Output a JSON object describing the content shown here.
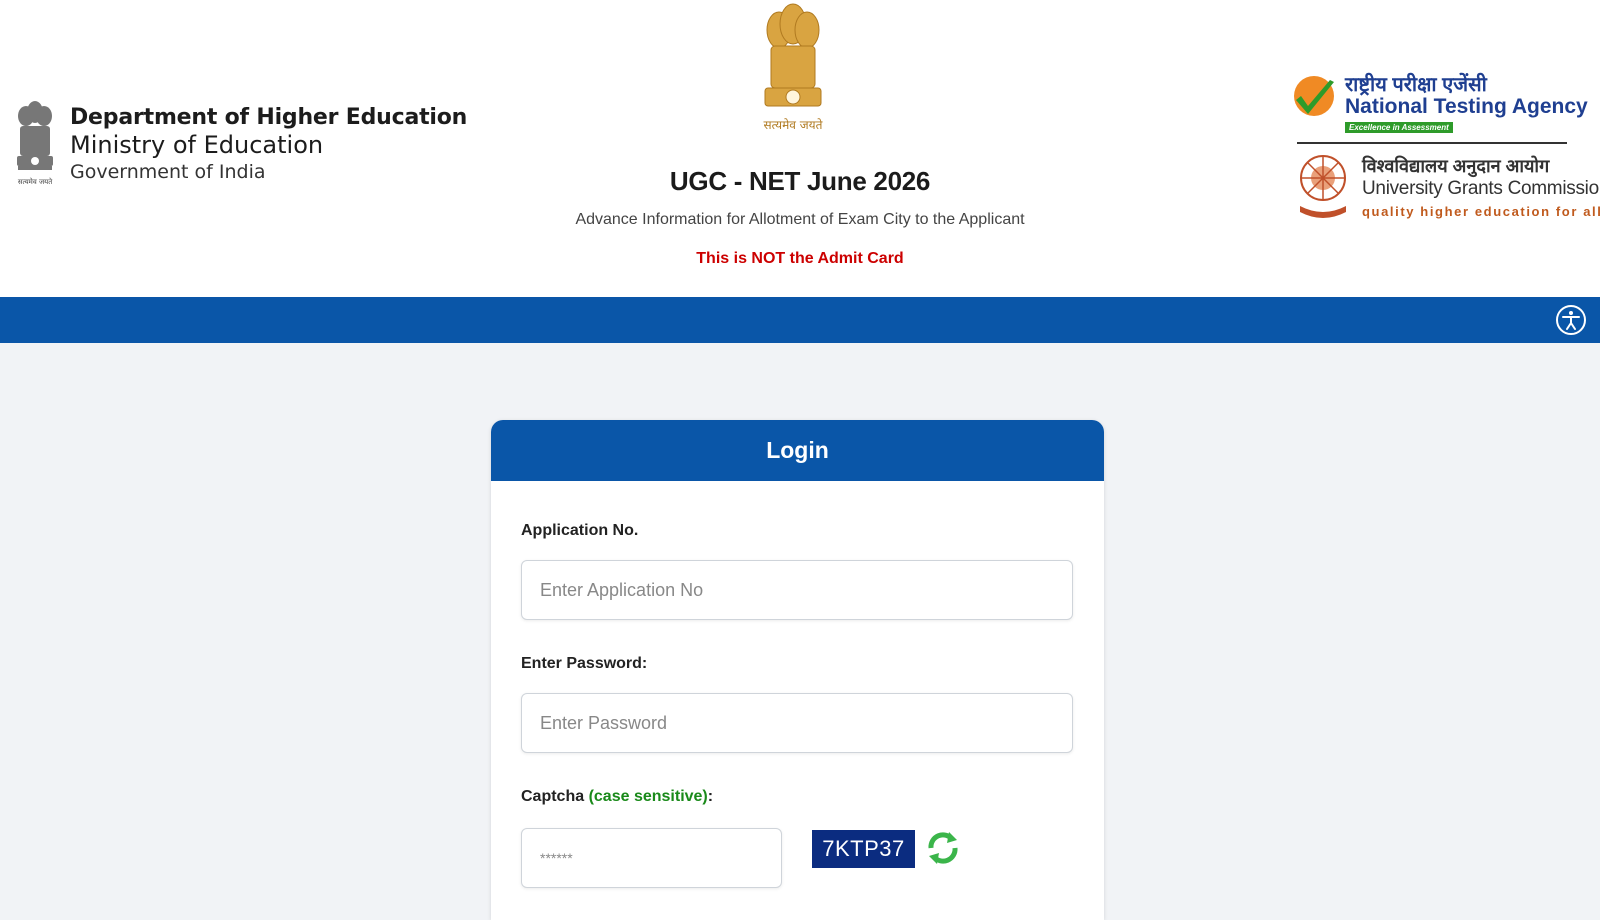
{
  "header": {
    "left": {
      "line1": "Department of Higher Education",
      "line2": "Ministry of Education",
      "line3": "Government of India",
      "emblem_motto": "सत्यमेव जयते"
    },
    "center": {
      "emblem_motto": "सत्यमेव जयते",
      "title": "UGC - NET June 2026",
      "subtitle": "Advance Information for Allotment of Exam City to the Applicant",
      "warning": "This is NOT the Admit Card"
    },
    "nta": {
      "hindi": "राष्ट्रीय परीक्षा एजेंसी",
      "english": "National Testing Agency",
      "tagline": "Excellence in Assessment"
    },
    "ugc": {
      "hindi": "विश्वविद्यालय अनुदान आयोग",
      "english": "University Grants Commission",
      "tagline": "quality higher education for all"
    }
  },
  "toolbar": {
    "accessibility_icon": "accessibility-icon"
  },
  "login": {
    "title": "Login",
    "app_label": "Application No.",
    "app_placeholder": "Enter Application No",
    "pwd_label": "Enter Password:",
    "pwd_placeholder": "Enter Password",
    "captcha_label": "Captcha",
    "captcha_hint": "(case sensitive)",
    "captcha_suffix": ":",
    "captcha_placeholder": "******",
    "captcha_code": "7KTP37",
    "refresh_icon": "refresh-icon"
  },
  "colors": {
    "primary_blue": "#0a56a8",
    "warning_red": "#cc0000",
    "hint_green": "#1a8a1a",
    "captcha_bg": "#0b2c80"
  }
}
